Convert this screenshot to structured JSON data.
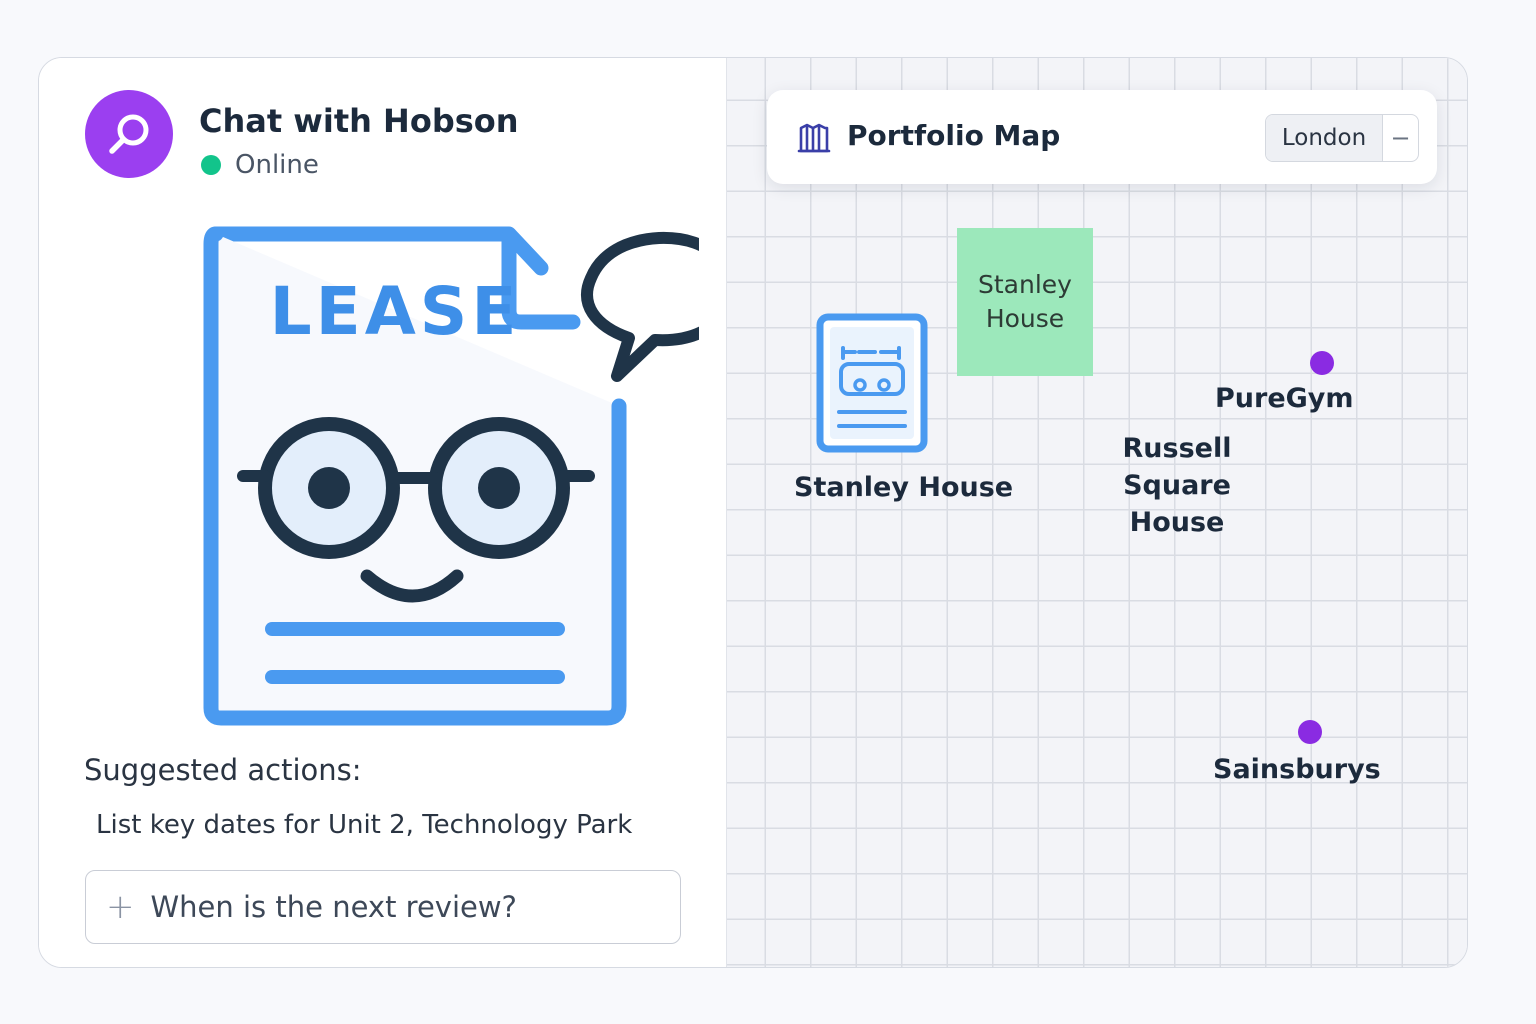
{
  "chat": {
    "title": "Chat with Hobson",
    "status": "Online",
    "illustration_text": "LEASE",
    "suggested_label": "Suggested actions:",
    "suggestion": "List key dates for Unit 2, Technology Park",
    "input_text": "When is the next review?"
  },
  "map": {
    "title": "Portfolio Map",
    "region": "London",
    "minus": "−",
    "block_label": "Stanley House",
    "property_label": "Stanley House",
    "labels": {
      "russell": "Russell Square House",
      "puregym": "PureGym",
      "sainsburys": "Sainsburys"
    }
  },
  "colors": {
    "accent": "#9b3ff0",
    "online": "#12c48b",
    "doc_blue": "#4a9af0",
    "navy": "#1f3448",
    "pin": "#8a2be2",
    "block": "#9ce8bb"
  }
}
